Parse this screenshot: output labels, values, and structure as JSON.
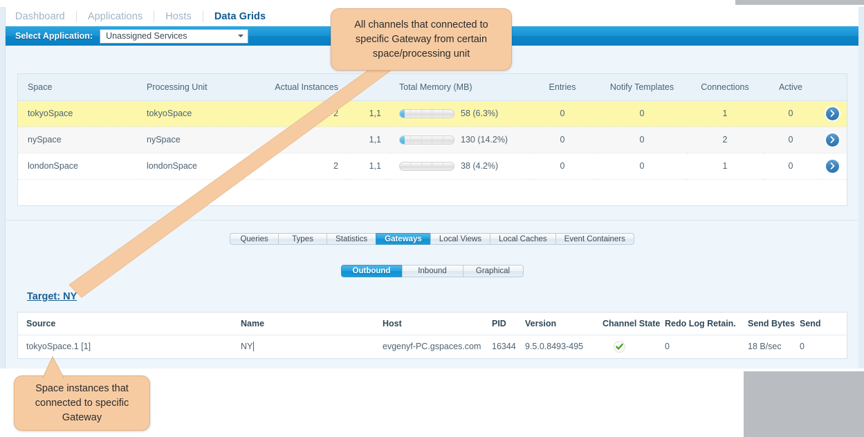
{
  "nav": {
    "items": [
      {
        "label": "Dashboard",
        "active": false
      },
      {
        "label": "Applications",
        "active": false
      },
      {
        "label": "Hosts",
        "active": false
      },
      {
        "label": "Data Grids",
        "active": true
      }
    ]
  },
  "appbar": {
    "label": "Select Application:",
    "selected": "Unassigned Services",
    "caret_icon": "chevron-down-icon"
  },
  "spaces_table": {
    "headers": [
      "Space",
      "Processing Unit",
      "Actual Instances",
      "",
      "Total Memory (MB)",
      "Entries",
      "Notify Templates",
      "Connections",
      "Active",
      ""
    ],
    "rows": [
      {
        "space": "tokyoSpace",
        "processing_unit": "tokyoSpace",
        "actual_instances": "2",
        "instances_ratio": "1,1",
        "memory_text": "58 (6.3%)",
        "memory_pct": 6.3,
        "entries": "0",
        "notify_templates": "0",
        "connections": "1",
        "active": "0",
        "selected": true
      },
      {
        "space": "nySpace",
        "processing_unit": "nySpace",
        "actual_instances": "",
        "instances_ratio": "1,1",
        "memory_text": "130 (14.2%)",
        "memory_pct": 14.2,
        "entries": "0",
        "notify_templates": "0",
        "connections": "2",
        "active": "0",
        "selected": false
      },
      {
        "space": "londonSpace",
        "processing_unit": "londonSpace",
        "actual_instances": "2",
        "instances_ratio": "1,1",
        "memory_text": "38 (4.2%)",
        "memory_pct": 0,
        "entries": "0",
        "notify_templates": "0",
        "connections": "1",
        "active": "0",
        "selected": false
      }
    ],
    "row_action_icon": "chevron-right-icon"
  },
  "main_tabs": [
    {
      "label": "Queries",
      "active": false
    },
    {
      "label": "Types",
      "active": false
    },
    {
      "label": "Statistics",
      "active": false
    },
    {
      "label": "Gateways",
      "active": true
    },
    {
      "label": "Local Views",
      "active": false
    },
    {
      "label": "Local Caches",
      "active": false
    },
    {
      "label": "Event Containers",
      "active": false
    }
  ],
  "sub_tabs": [
    {
      "label": "Outbound",
      "active": true
    },
    {
      "label": "Inbound",
      "active": false
    },
    {
      "label": "Graphical",
      "active": false
    }
  ],
  "target": {
    "label": "Target: NY"
  },
  "gateway_table": {
    "headers": [
      "Source",
      "Name",
      "Host",
      "PID",
      "Version",
      "Channel State",
      "Redo Log Retain.",
      "Send Bytes",
      "Send"
    ],
    "rows": [
      {
        "source": "tokyoSpace.1 [1]",
        "name": "NY",
        "host": "evgenyf-PC.gspaces.com",
        "pid": "16344",
        "version": "9.5.0.8493-495",
        "channel_state_icon": "green-check-icon",
        "redo_log_retain": "0",
        "send_bytes": "18 B/sec",
        "send": "0"
      }
    ]
  },
  "callouts": {
    "top": "All channels that connected to specific Gateway from certain space/processing unit",
    "bottom": "Space instances that connected to specific Gateway"
  },
  "colors": {
    "accent_blue": "#0d86c9",
    "active_tab_blue": "#1a9bda",
    "selected_row_yellow": "#fcf7ab",
    "callout_peach": "#f7cba2",
    "link_blue": "#1a5f93",
    "status_green": "#4aa521"
  }
}
